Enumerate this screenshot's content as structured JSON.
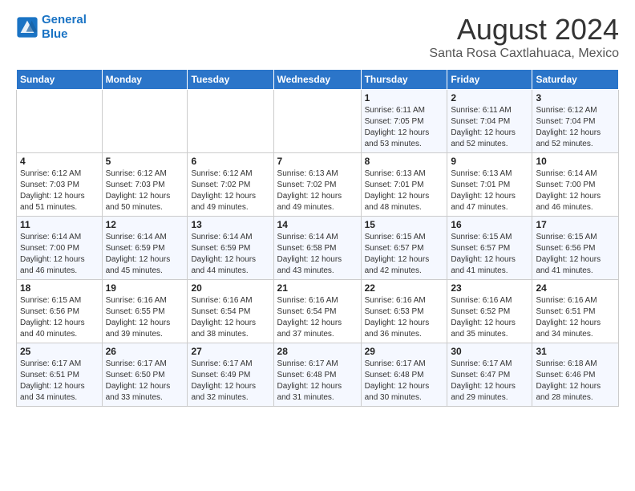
{
  "header": {
    "logo_line1": "General",
    "logo_line2": "Blue",
    "title": "August 2024",
    "subtitle": "Santa Rosa Caxtlahuaca, Mexico"
  },
  "weekdays": [
    "Sunday",
    "Monday",
    "Tuesday",
    "Wednesday",
    "Thursday",
    "Friday",
    "Saturday"
  ],
  "weeks": [
    [
      {
        "day": "",
        "info": ""
      },
      {
        "day": "",
        "info": ""
      },
      {
        "day": "",
        "info": ""
      },
      {
        "day": "",
        "info": ""
      },
      {
        "day": "1",
        "info": "Sunrise: 6:11 AM\nSunset: 7:05 PM\nDaylight: 12 hours\nand 53 minutes."
      },
      {
        "day": "2",
        "info": "Sunrise: 6:11 AM\nSunset: 7:04 PM\nDaylight: 12 hours\nand 52 minutes."
      },
      {
        "day": "3",
        "info": "Sunrise: 6:12 AM\nSunset: 7:04 PM\nDaylight: 12 hours\nand 52 minutes."
      }
    ],
    [
      {
        "day": "4",
        "info": "Sunrise: 6:12 AM\nSunset: 7:03 PM\nDaylight: 12 hours\nand 51 minutes."
      },
      {
        "day": "5",
        "info": "Sunrise: 6:12 AM\nSunset: 7:03 PM\nDaylight: 12 hours\nand 50 minutes."
      },
      {
        "day": "6",
        "info": "Sunrise: 6:12 AM\nSunset: 7:02 PM\nDaylight: 12 hours\nand 49 minutes."
      },
      {
        "day": "7",
        "info": "Sunrise: 6:13 AM\nSunset: 7:02 PM\nDaylight: 12 hours\nand 49 minutes."
      },
      {
        "day": "8",
        "info": "Sunrise: 6:13 AM\nSunset: 7:01 PM\nDaylight: 12 hours\nand 48 minutes."
      },
      {
        "day": "9",
        "info": "Sunrise: 6:13 AM\nSunset: 7:01 PM\nDaylight: 12 hours\nand 47 minutes."
      },
      {
        "day": "10",
        "info": "Sunrise: 6:14 AM\nSunset: 7:00 PM\nDaylight: 12 hours\nand 46 minutes."
      }
    ],
    [
      {
        "day": "11",
        "info": "Sunrise: 6:14 AM\nSunset: 7:00 PM\nDaylight: 12 hours\nand 46 minutes."
      },
      {
        "day": "12",
        "info": "Sunrise: 6:14 AM\nSunset: 6:59 PM\nDaylight: 12 hours\nand 45 minutes."
      },
      {
        "day": "13",
        "info": "Sunrise: 6:14 AM\nSunset: 6:59 PM\nDaylight: 12 hours\nand 44 minutes."
      },
      {
        "day": "14",
        "info": "Sunrise: 6:14 AM\nSunset: 6:58 PM\nDaylight: 12 hours\nand 43 minutes."
      },
      {
        "day": "15",
        "info": "Sunrise: 6:15 AM\nSunset: 6:57 PM\nDaylight: 12 hours\nand 42 minutes."
      },
      {
        "day": "16",
        "info": "Sunrise: 6:15 AM\nSunset: 6:57 PM\nDaylight: 12 hours\nand 41 minutes."
      },
      {
        "day": "17",
        "info": "Sunrise: 6:15 AM\nSunset: 6:56 PM\nDaylight: 12 hours\nand 41 minutes."
      }
    ],
    [
      {
        "day": "18",
        "info": "Sunrise: 6:15 AM\nSunset: 6:56 PM\nDaylight: 12 hours\nand 40 minutes."
      },
      {
        "day": "19",
        "info": "Sunrise: 6:16 AM\nSunset: 6:55 PM\nDaylight: 12 hours\nand 39 minutes."
      },
      {
        "day": "20",
        "info": "Sunrise: 6:16 AM\nSunset: 6:54 PM\nDaylight: 12 hours\nand 38 minutes."
      },
      {
        "day": "21",
        "info": "Sunrise: 6:16 AM\nSunset: 6:54 PM\nDaylight: 12 hours\nand 37 minutes."
      },
      {
        "day": "22",
        "info": "Sunrise: 6:16 AM\nSunset: 6:53 PM\nDaylight: 12 hours\nand 36 minutes."
      },
      {
        "day": "23",
        "info": "Sunrise: 6:16 AM\nSunset: 6:52 PM\nDaylight: 12 hours\nand 35 minutes."
      },
      {
        "day": "24",
        "info": "Sunrise: 6:16 AM\nSunset: 6:51 PM\nDaylight: 12 hours\nand 34 minutes."
      }
    ],
    [
      {
        "day": "25",
        "info": "Sunrise: 6:17 AM\nSunset: 6:51 PM\nDaylight: 12 hours\nand 34 minutes."
      },
      {
        "day": "26",
        "info": "Sunrise: 6:17 AM\nSunset: 6:50 PM\nDaylight: 12 hours\nand 33 minutes."
      },
      {
        "day": "27",
        "info": "Sunrise: 6:17 AM\nSunset: 6:49 PM\nDaylight: 12 hours\nand 32 minutes."
      },
      {
        "day": "28",
        "info": "Sunrise: 6:17 AM\nSunset: 6:48 PM\nDaylight: 12 hours\nand 31 minutes."
      },
      {
        "day": "29",
        "info": "Sunrise: 6:17 AM\nSunset: 6:48 PM\nDaylight: 12 hours\nand 30 minutes."
      },
      {
        "day": "30",
        "info": "Sunrise: 6:17 AM\nSunset: 6:47 PM\nDaylight: 12 hours\nand 29 minutes."
      },
      {
        "day": "31",
        "info": "Sunrise: 6:18 AM\nSunset: 6:46 PM\nDaylight: 12 hours\nand 28 minutes."
      }
    ]
  ]
}
